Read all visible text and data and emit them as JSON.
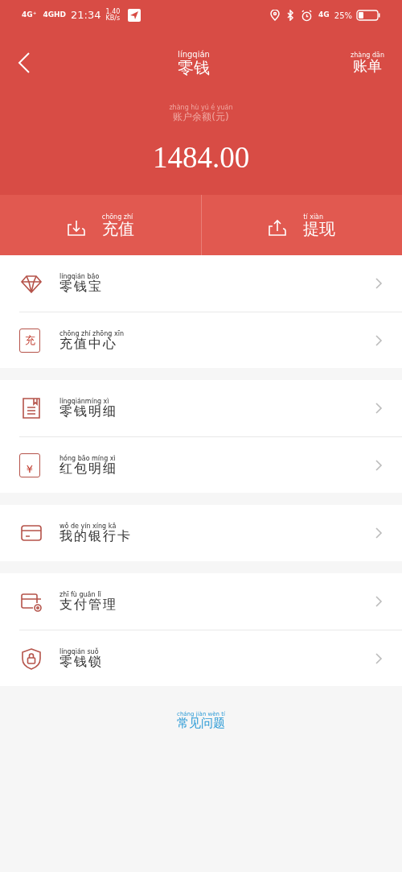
{
  "status_bar": {
    "network_1": "4G⁺",
    "network_2": "4GHD",
    "time": "21:34",
    "speed": "1.40",
    "speed_unit": "KB/s",
    "network_3": "4G",
    "battery": "25%"
  },
  "header": {
    "title_pinyin": "língqián",
    "title": "零钱",
    "bill_pinyin": "zhàng dān",
    "bill": "账单"
  },
  "balance": {
    "label_pinyin": "zhàng hù yú é yuán",
    "label": "账户余额(元)",
    "amount": "1484.00"
  },
  "actions": [
    {
      "kind": "recharge",
      "pinyin": "chōng zhí",
      "label": "充值"
    },
    {
      "kind": "withdraw",
      "pinyin": "tí xiàn",
      "label": "提现"
    }
  ],
  "groups": [
    [
      {
        "kind": "diamond",
        "pinyin": "língqián bǎo",
        "label": "零钱宝"
      },
      {
        "kind": "recharge-center",
        "icon_text": "充",
        "pinyin": "chōng zhí zhōng xīn",
        "label": "充值中心"
      }
    ],
    [
      {
        "kind": "document",
        "pinyin": "língqiánmíng xì",
        "label": "零钱明细"
      },
      {
        "kind": "red-packet",
        "icon_text": "¥",
        "pinyin": "hóng bāo míng xì",
        "label": "红包明细"
      }
    ],
    [
      {
        "kind": "card",
        "pinyin": "wǒ de yín xíng kǎ",
        "label": "我的银行卡"
      }
    ],
    [
      {
        "kind": "card-settings",
        "pinyin": "zhī fù guǎn lǐ",
        "label": "支付管理"
      },
      {
        "kind": "shield-lock",
        "pinyin": "língqián suǒ",
        "label": "零钱锁"
      }
    ]
  ],
  "faq": {
    "pinyin": "cháng jiàn wèn tí",
    "label": "常见问题"
  }
}
